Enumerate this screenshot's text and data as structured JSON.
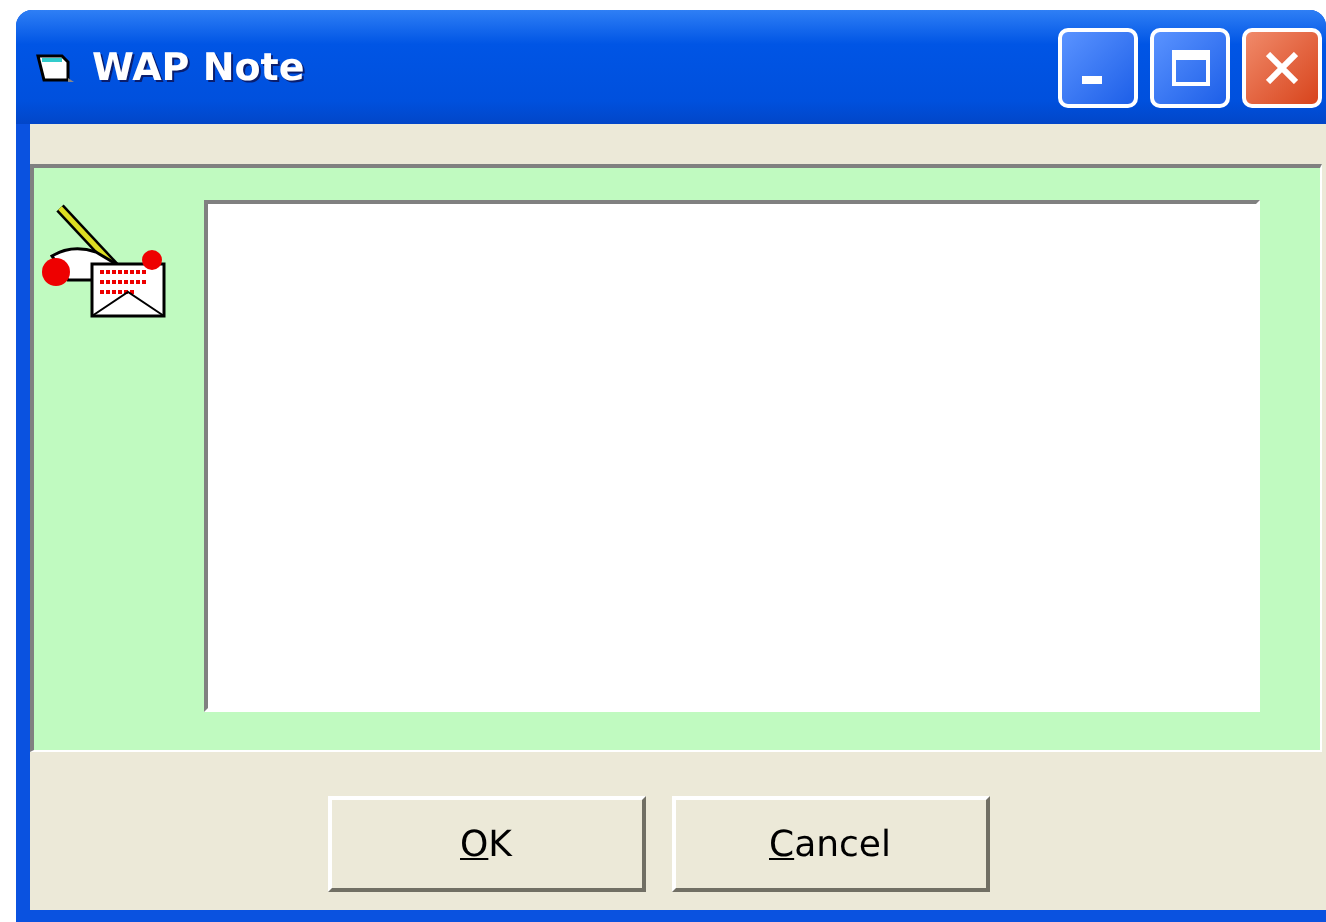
{
  "window": {
    "title": "WAP Note"
  },
  "buttons": [
    {
      "label": "OK",
      "mnemonic_underlined": true
    },
    {
      "label": "Cancel",
      "mnemonic_underlined": true
    }
  ]
}
